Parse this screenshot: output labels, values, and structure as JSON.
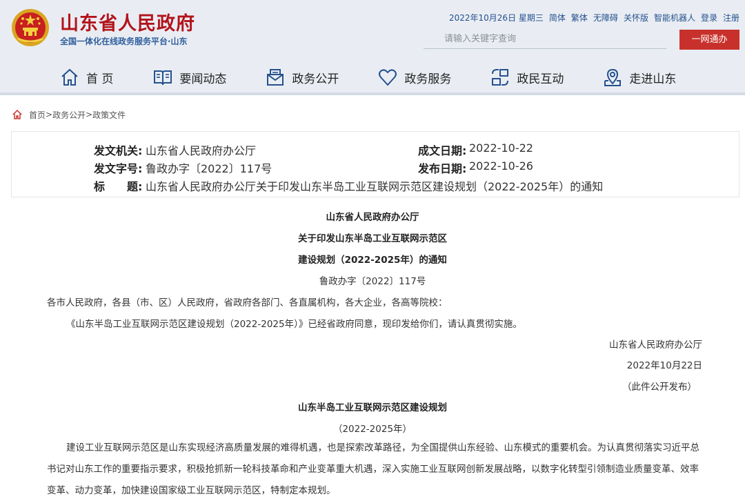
{
  "header": {
    "site_title": "山东省人民政府",
    "site_subtitle": "全国一体化在线政务服务平台·山东",
    "top_links": [
      "2022年10月26日 星期三",
      "简体",
      "繁体",
      "无障碍",
      "关怀版",
      "智能机器人",
      "登录",
      "注册"
    ],
    "search_placeholder": "请输入关键字查询",
    "login_button": "一网通办",
    "nav": [
      {
        "label": "首 页",
        "icon": "home-icon"
      },
      {
        "label": "要闻动态",
        "icon": "book-icon"
      },
      {
        "label": "政务公开",
        "icon": "mail-icon"
      },
      {
        "label": "政务服务",
        "icon": "heart-icon"
      },
      {
        "label": "政民互动",
        "icon": "interaction-icon"
      },
      {
        "label": "走进山东",
        "icon": "map-pin-icon"
      }
    ],
    "colors": {
      "brand_red": "#b3131b",
      "subtitle_blue": "#2f5e9c",
      "button_red": "#c8312b"
    }
  },
  "breadcrumb": {
    "items": [
      "首页",
      "政务公开",
      "政策文件"
    ],
    "separator": ">"
  },
  "meta": {
    "issuer_label": "发文机关:",
    "issuer_value": "山东省人民政府办公厅",
    "date_written_label": "成文日期:",
    "date_written_value": "2022-10-22",
    "doc_no_label": "发文字号:",
    "doc_no_value": "鲁政办字〔2022〕117号",
    "publish_date_label": "发布日期:",
    "publish_date_value": "2022-10-26",
    "title_label": "标　　题:",
    "title_value": "山东省人民政府办公厅关于印发山东半岛工业互联网示范区建设规划（2022-2025年）的通知"
  },
  "article": {
    "heading_1": "山东省人民政府办公厅",
    "heading_2": "关于印发山东半岛工业互联网示范区",
    "heading_3": "建设规划（2022-2025年）的通知",
    "doc_number": "鲁政办字〔2022〕117号",
    "recipients": "各市人民政府，各县（市、区）人民政府，省政府各部门、各直属机构，各大企业，各高等院校：",
    "body_1": "《山东半岛工业互联网示范区建设规划（2022-2025年）》已经省政府同意，现印发给你们，请认真贯彻实施。",
    "signature": "山东省人民政府办公厅",
    "signature_date": "2022年10月22日",
    "publish_note": "（此件公开发布）",
    "plan_title": "山东半岛工业互联网示范区建设规划",
    "plan_years": "（2022-2025年）",
    "plan_intro": "建设工业互联网示范区是山东实现经济高质量发展的难得机遇，也是探索改革路径，为全国提供山东经验、山东模式的重要机会。为认真贯彻落实习近平总书记对山东工作的重要指示要求，积极抢抓新一轮科技革命和产业变革重大机遇，深入实施工业互联网创新发展战略，以数字化转型引领制造业质量变革、效率变革、动力变革，加快建设国家级工业互联网示范区，特制定本规划。"
  }
}
